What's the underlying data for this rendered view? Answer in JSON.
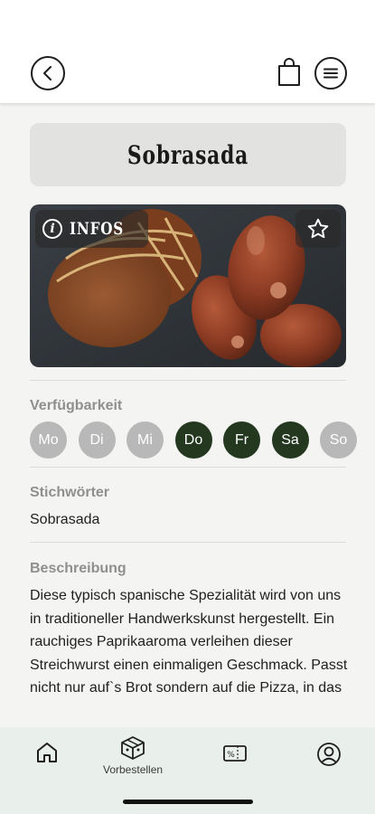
{
  "header": {
    "back_icon": "chevron-left-icon",
    "cart_icon": "shopping-bag-icon",
    "menu_icon": "menu-icon"
  },
  "product": {
    "title": "Sobrasada",
    "image_badge_label": "INFOS",
    "favorite_icon": "star-icon"
  },
  "availability": {
    "label": "Verfügbarkeit",
    "days": [
      {
        "label": "Mo",
        "available": false
      },
      {
        "label": "Di",
        "available": false
      },
      {
        "label": "Mi",
        "available": false
      },
      {
        "label": "Do",
        "available": true
      },
      {
        "label": "Fr",
        "available": true
      },
      {
        "label": "Sa",
        "available": true
      },
      {
        "label": "So",
        "available": false
      }
    ]
  },
  "keywords": {
    "label": "Stichwörter",
    "value": "Sobrasada"
  },
  "description": {
    "label": "Beschreibung",
    "text": "Diese typisch spanische Spezialität wird von uns in traditioneller Handwerkskunst hergestellt. Ein rauchiges Paprikaaroma verleihen dieser Streichwurst einen einmaligen Geschmack. Passt nicht nur auf`s Brot sondern auf die Pizza, in das"
  },
  "tabbar": {
    "tabs": [
      {
        "icon": "home-icon",
        "label": ""
      },
      {
        "icon": "box-icon",
        "label": "Vorbestellen"
      },
      {
        "icon": "voucher-icon",
        "label": ""
      },
      {
        "icon": "profile-icon",
        "label": ""
      }
    ]
  },
  "colors": {
    "available_day": "#23381f",
    "unavailable_day": "#b8b8b8",
    "tabbar_background": "#e9efeb"
  }
}
